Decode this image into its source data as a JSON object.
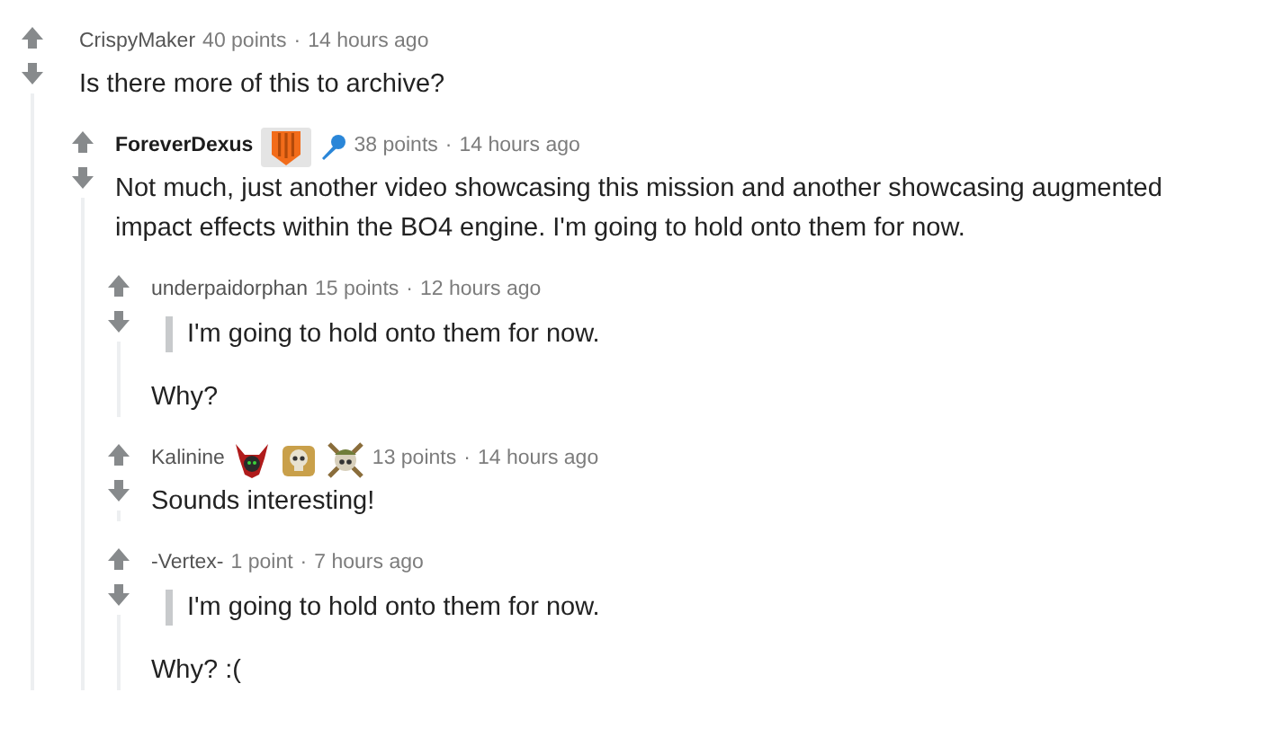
{
  "comments": [
    {
      "author": "CrispyMaker",
      "op": false,
      "points": "40 points",
      "separator": "·",
      "time": "14 hours ago",
      "body": [
        {
          "kind": "text",
          "text": "Is there more of this to archive?"
        }
      ],
      "children": [
        {
          "author": "ForeverDexus",
          "op": true,
          "flairs": [
            {
              "kind": "shield"
            },
            {
              "kind": "mic"
            }
          ],
          "points": "38 points",
          "separator": "·",
          "time": "14 hours ago",
          "body": [
            {
              "kind": "text",
              "text": "Not much, just another video showcasing this mission and another showcasing augmented impact effects within the BO4 engine. I'm going to hold onto them for now."
            }
          ],
          "children": [
            {
              "author": "underpaidorphan",
              "op": false,
              "points": "15 points",
              "separator": "·",
              "time": "12 hours ago",
              "body": [
                {
                  "kind": "quote",
                  "text": "I'm going to hold onto them for now."
                },
                {
                  "kind": "text",
                  "text": "Why?"
                }
              ]
            },
            {
              "author": "Kalinine",
              "op": false,
              "flairs": [
                {
                  "kind": "horned"
                },
                {
                  "kind": "skull"
                },
                {
                  "kind": "crossed"
                }
              ],
              "points": "13 points",
              "separator": "·",
              "time": "14 hours ago",
              "body": [
                {
                  "kind": "text",
                  "text": "Sounds interesting!"
                }
              ]
            },
            {
              "author": "-Vertex-",
              "op": false,
              "points": "1 point",
              "separator": "·",
              "time": "7 hours ago",
              "body": [
                {
                  "kind": "quote",
                  "text": "I'm going to hold onto them for now."
                },
                {
                  "kind": "text",
                  "text": "Why? :("
                }
              ]
            }
          ]
        }
      ]
    }
  ]
}
